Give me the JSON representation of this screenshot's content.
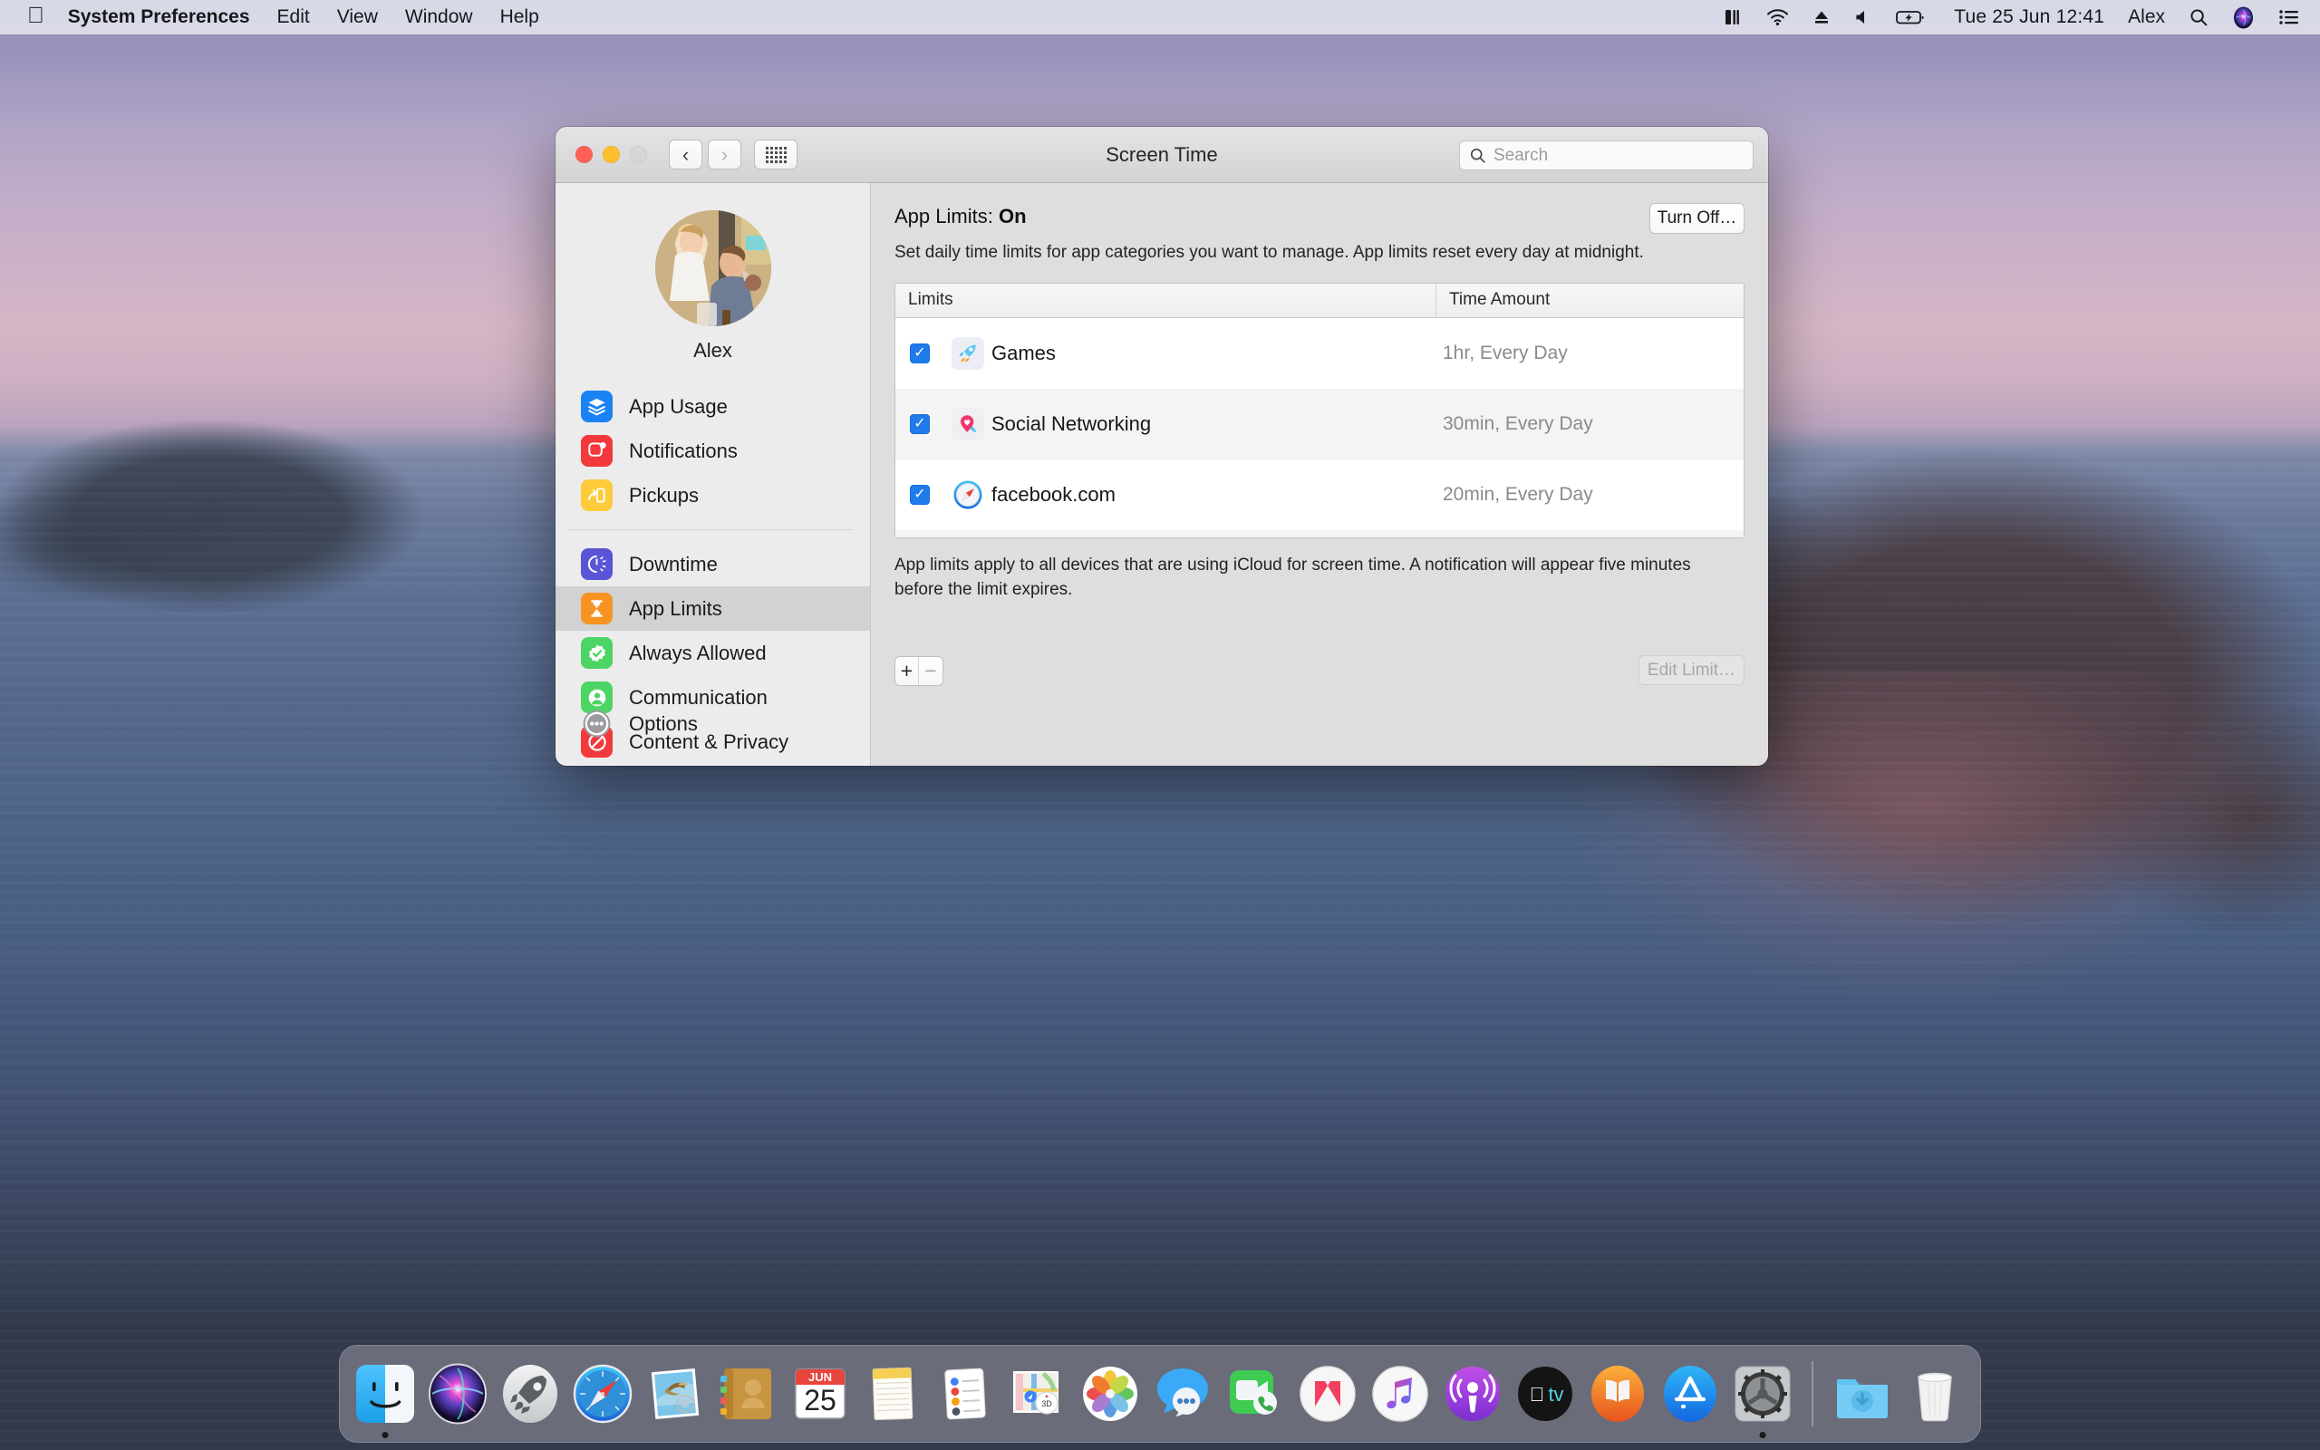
{
  "menubar": {
    "apple_icon": "apple-logo",
    "items": [
      {
        "label": "System Preferences",
        "bold": true
      },
      {
        "label": "Edit",
        "bold": false
      },
      {
        "label": "View",
        "bold": false
      },
      {
        "label": "Window",
        "bold": false
      },
      {
        "label": "Help",
        "bold": false
      }
    ],
    "status_icons": [
      "split-view-icon",
      "wifi-icon",
      "eject-icon",
      "volume-icon",
      "battery-charging-icon"
    ],
    "clock": "Tue 25 Jun  12:41",
    "user": "Alex",
    "right_icons": [
      "search-icon",
      "siri-icon",
      "control-center-icon"
    ]
  },
  "window": {
    "title": "Screen Time",
    "traffic_lights": [
      "close",
      "minimize",
      "zoom"
    ],
    "back_label": "‹",
    "forward_label": "›",
    "grid_label": "show-all-grid",
    "search": {
      "value": "",
      "placeholder": "Search"
    }
  },
  "sidebar": {
    "user_name": "Alex",
    "groups": [
      {
        "items": [
          {
            "label": "App Usage",
            "icon": "layers-icon",
            "color": "#1b82f4",
            "selected": false
          },
          {
            "label": "Notifications",
            "icon": "notification-square-icon",
            "color": "#f4393c",
            "selected": false
          },
          {
            "label": "Pickups",
            "icon": "pickup-phone-icon",
            "color": "#fecc3b",
            "selected": false
          }
        ]
      },
      {
        "items": [
          {
            "label": "Downtime",
            "icon": "downtime-clock-icon",
            "color": "#5a54d6",
            "selected": false
          },
          {
            "label": "App Limits",
            "icon": "hourglass-icon",
            "color": "#f79323",
            "selected": true
          },
          {
            "label": "Always Allowed",
            "icon": "allowed-badge-icon",
            "color": "#4cd564",
            "selected": false
          },
          {
            "label": "Communication",
            "icon": "person-circle-icon",
            "color": "#4cd564",
            "selected": false
          },
          {
            "label": "Content & Privacy",
            "icon": "no-entry-icon",
            "color": "#f4393c",
            "selected": false
          }
        ]
      }
    ],
    "options": {
      "label": "Options",
      "icon": "ellipsis-circle-icon",
      "color": "#9a9a9f"
    }
  },
  "main": {
    "status_prefix": "App Limits:",
    "status_value": "On",
    "turn_off_label": "Turn Off…",
    "description": "Set daily time limits for app categories you want to manage. App limits reset every day at midnight.",
    "table": {
      "headers": [
        "Limits",
        "Time Amount"
      ],
      "rows": [
        {
          "checked": true,
          "icon": "rocket-icon",
          "name": "Games",
          "time": "1hr, Every Day"
        },
        {
          "checked": true,
          "icon": "social-heart-pin-icon",
          "name": "Social Networking",
          "time": "30min, Every Day"
        },
        {
          "checked": true,
          "icon": "safari-compass-icon",
          "name": "facebook.com",
          "time": "20min, Every Day"
        }
      ],
      "empty_rows": 2
    },
    "footnote": "App limits apply to all devices that are using iCloud for screen time. A notification will appear five minutes before the limit expires.",
    "add_label": "+",
    "remove_label": "−",
    "edit_limit_label": "Edit Limit…"
  },
  "dock": {
    "items": [
      {
        "name": "Finder",
        "icon": "finder-icon",
        "running": true
      },
      {
        "name": "Siri",
        "icon": "siri-icon",
        "running": false
      },
      {
        "name": "Launchpad",
        "icon": "launchpad-icon",
        "running": false
      },
      {
        "name": "Safari",
        "icon": "safari-icon",
        "running": false
      },
      {
        "name": "Mail",
        "icon": "mail-icon",
        "running": false
      },
      {
        "name": "Contacts",
        "icon": "contacts-icon",
        "running": false
      },
      {
        "name": "Calendar",
        "icon": "calendar-icon",
        "running": false,
        "month": "JUN",
        "day": "25"
      },
      {
        "name": "Notes",
        "icon": "notes-icon",
        "running": false
      },
      {
        "name": "Reminders",
        "icon": "reminders-icon",
        "running": false
      },
      {
        "name": "Maps",
        "icon": "maps-icon",
        "running": false
      },
      {
        "name": "Photos",
        "icon": "photos-icon",
        "running": false
      },
      {
        "name": "Messages",
        "icon": "messages-icon",
        "running": false
      },
      {
        "name": "FaceTime",
        "icon": "facetime-icon",
        "running": false
      },
      {
        "name": "News",
        "icon": "news-icon",
        "running": false
      },
      {
        "name": "Music",
        "icon": "music-icon",
        "running": false
      },
      {
        "name": "Podcasts",
        "icon": "podcasts-icon",
        "running": false
      },
      {
        "name": "TV",
        "icon": "appletv-icon",
        "running": false
      },
      {
        "name": "Books",
        "icon": "books-icon",
        "running": false
      },
      {
        "name": "App Store",
        "icon": "appstore-icon",
        "running": false
      },
      {
        "name": "System Preferences",
        "icon": "gear-icon",
        "running": true
      }
    ],
    "right_items": [
      {
        "name": "Downloads",
        "icon": "downloads-folder-icon"
      },
      {
        "name": "Trash",
        "icon": "trash-icon"
      }
    ]
  },
  "colors": {
    "accent": "#1f7aeb",
    "window_bg": "#dedede",
    "sidebar_bg": "#ececec",
    "selected_row": "#d2d2d2"
  }
}
